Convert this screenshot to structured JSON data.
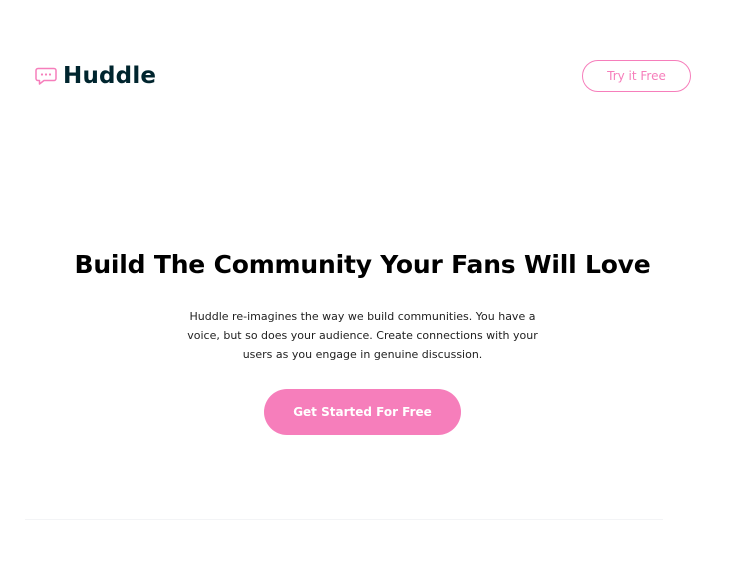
{
  "header": {
    "logo_text": "Huddle",
    "logo_icon": "chat-bubble-icon",
    "try_button_label": "Try it Free"
  },
  "hero": {
    "title": "Build The Community Your Fans Will Love",
    "description": "Huddle re-imagines the way we build communities. You have a voice, but so does your audience. Create connections with your users as you engage in genuine discussion.",
    "cta_label": "Get Started For Free"
  },
  "colors": {
    "accent": "#f67ebb",
    "brand_dark": "#00252e"
  }
}
